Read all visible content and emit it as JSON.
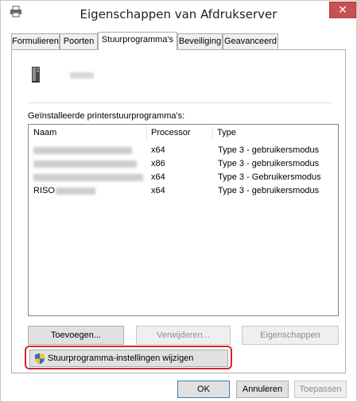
{
  "window": {
    "title": "Eigenschappen van Afdrukserver",
    "close_label": "✕"
  },
  "tabs": [
    {
      "label": "Formulieren"
    },
    {
      "label": "Poorten"
    },
    {
      "label": "Stuurprogramma's",
      "active": true
    },
    {
      "label": "Beveiliging"
    },
    {
      "label": "Geavanceerd"
    }
  ],
  "drivers": {
    "installed_label": "Geïnstalleerde printerstuurprogramma's:",
    "columns": {
      "name": "Naam",
      "processor": "Processor",
      "type": "Type"
    },
    "rows": [
      {
        "name": "",
        "processor": "x64",
        "type": "Type 3 - gebruikersmodus"
      },
      {
        "name": "",
        "processor": "x86",
        "type": "Type 3 - gebruikersmodus"
      },
      {
        "name": "",
        "processor": "x64",
        "type": "Type 3 - Gebruikersmodus"
      },
      {
        "name": "RISO",
        "processor": "x64",
        "type": "Type 3 - gebruikersmodus"
      }
    ]
  },
  "buttons": {
    "add": "Toevoegen...",
    "remove": "Verwijderen...",
    "properties": "Eigenschappen",
    "change_settings": "Stuurprogramma-instellingen wijzigen"
  },
  "footer": {
    "ok": "OK",
    "cancel": "Annuleren",
    "apply": "Toepassen"
  },
  "colors": {
    "close_button": "#c75050",
    "highlight_border": "#d8232a",
    "primary_border": "#3c7fb1"
  }
}
